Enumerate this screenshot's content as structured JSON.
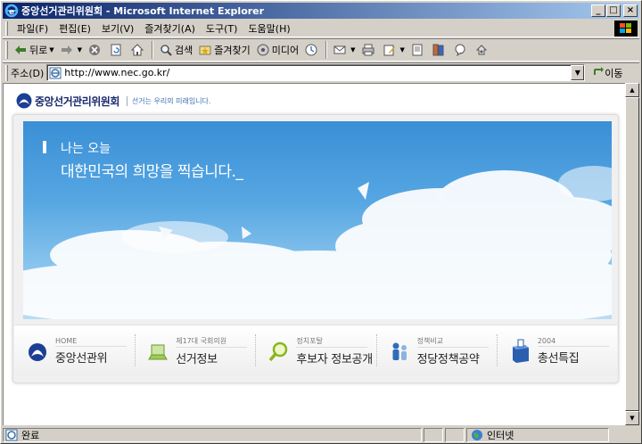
{
  "window": {
    "title": "중앙선거관리위원회 - Microsoft Internet Explorer",
    "controls": {
      "minimize": "_",
      "maximize": "□",
      "close": "×"
    }
  },
  "menu": {
    "items": [
      "파일(F)",
      "편집(E)",
      "보기(V)",
      "즐겨찾기(A)",
      "도구(T)",
      "도움말(H)"
    ]
  },
  "toolbar": {
    "back_label": "뒤로",
    "search_label": "검색",
    "favorites_label": "즐겨찾기",
    "media_label": "미디어"
  },
  "address": {
    "label": "주소(D)",
    "url": "http://www.nec.go.kr/",
    "go_label": "이동"
  },
  "site": {
    "name": "중앙선거관리위원회",
    "slogan": "선거는 우리의 미래입니다.",
    "hero_line1": "나는 오늘",
    "hero_line2": "대한민국의 희망을 찍습니다._",
    "nav": [
      {
        "sub": "HOME",
        "main": "중앙선관위"
      },
      {
        "sub": "제17대 국회의원",
        "main": "선거정보"
      },
      {
        "sub": "정치포탈",
        "main": "후보자 정보공개"
      },
      {
        "sub": "정책비교",
        "main": "정당정책공약"
      },
      {
        "sub": "2004",
        "main": "총선특집"
      }
    ]
  },
  "status": {
    "text": "완료",
    "zone": "인터넷"
  },
  "icons": {
    "ie": "ie-logo-icon",
    "back": "back-arrow-icon",
    "forward": "forward-arrow-icon",
    "stop": "stop-icon",
    "refresh": "refresh-icon",
    "home": "home-icon",
    "search": "search-icon",
    "favorites": "favorites-icon",
    "media": "media-icon",
    "history": "history-icon",
    "mail": "mail-icon",
    "print": "print-icon",
    "edit": "edit-icon"
  }
}
